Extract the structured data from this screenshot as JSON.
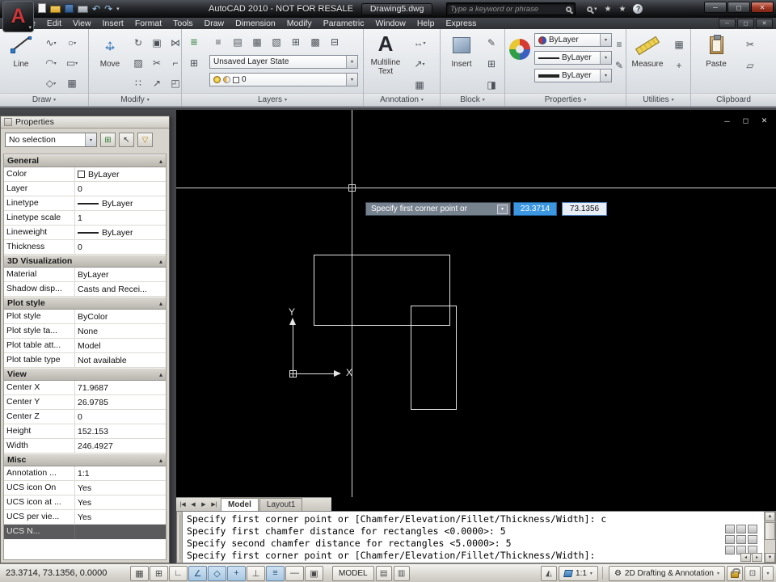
{
  "window": {
    "logo_letter": "A",
    "app_title": "AutoCAD 2010 - NOT FOR RESALE",
    "doc_title": "Drawing5.dwg"
  },
  "search": {
    "placeholder": "Type a keyword or phrase"
  },
  "menu": {
    "items": [
      "File",
      "Edit",
      "View",
      "Insert",
      "Format",
      "Tools",
      "Draw",
      "Dimension",
      "Modify",
      "Parametric",
      "Window",
      "Help",
      "Express"
    ]
  },
  "ribbon": {
    "draw": {
      "label": "Draw",
      "line": "Line",
      "icons": [
        "∿",
        "○",
        "◠",
        "▭",
        "◇",
        "▦"
      ]
    },
    "modify": {
      "label": "Modify",
      "move": "Move",
      "icons": [
        "↻",
        "▣",
        "⋈",
        "▨",
        "✂",
        "⌐",
        "∷",
        "↗",
        "◰"
      ]
    },
    "layers": {
      "label": "Layers",
      "state": "Unsaved Layer State",
      "current": "0",
      "icons": [
        "≡",
        "▤",
        "▦",
        "▧",
        "⊞",
        "▩",
        "⊟"
      ],
      "side_icons": [
        "≡",
        "⊞"
      ]
    },
    "annotation": {
      "label": "Annotation",
      "big_letter": "A",
      "multiline_text": "Multiline Text",
      "icons": [
        "↔",
        "↗",
        "▦"
      ]
    },
    "block": {
      "label": "Block",
      "insert": "Insert",
      "icons": [
        "✎",
        "⊞",
        "◨"
      ]
    },
    "properties": {
      "label": "Properties",
      "color": "ByLayer",
      "linetype": "ByLayer",
      "lineweight": "ByLayer",
      "side_icons": [
        "≡",
        "✎"
      ]
    },
    "utilities": {
      "label": "Utilities",
      "measure": "Measure",
      "icons": [
        "▦",
        "+"
      ]
    },
    "clipboard": {
      "label": "Clipboard",
      "paste": "Paste",
      "icons": [
        "✂",
        "▱"
      ]
    }
  },
  "palette": {
    "title": "Properties",
    "selection": "No selection",
    "sections": [
      {
        "name": "General",
        "rows": [
          {
            "label": "Color",
            "value": "ByLayer"
          },
          {
            "label": "Layer",
            "value": "0"
          },
          {
            "label": "Linetype",
            "value": "ByLayer"
          },
          {
            "label": "Linetype scale",
            "value": "1"
          },
          {
            "label": "Lineweight",
            "value": "ByLayer"
          },
          {
            "label": "Thickness",
            "value": "0"
          }
        ]
      },
      {
        "name": "3D Visualization",
        "rows": [
          {
            "label": "Material",
            "value": "ByLayer"
          },
          {
            "label": "Shadow disp...",
            "value": "Casts and Recei..."
          }
        ]
      },
      {
        "name": "Plot style",
        "rows": [
          {
            "label": "Plot style",
            "value": "ByColor"
          },
          {
            "label": "Plot style ta...",
            "value": "None"
          },
          {
            "label": "Plot table att...",
            "value": "Model"
          },
          {
            "label": "Plot table type",
            "value": "Not available"
          }
        ]
      },
      {
        "name": "View",
        "rows": [
          {
            "label": "Center X",
            "value": "71.9687"
          },
          {
            "label": "Center Y",
            "value": "26.9785"
          },
          {
            "label": "Center Z",
            "value": "0"
          },
          {
            "label": "Height",
            "value": "152.153"
          },
          {
            "label": "Width",
            "value": "246.4927"
          }
        ]
      },
      {
        "name": "Misc",
        "rows": [
          {
            "label": "Annotation ...",
            "value": "1:1"
          },
          {
            "label": "UCS icon On",
            "value": "Yes"
          },
          {
            "label": "UCS icon at ...",
            "value": "Yes"
          },
          {
            "label": "UCS per vie...",
            "value": "Yes"
          },
          {
            "label": "UCS N...",
            "value": ""
          }
        ]
      }
    ]
  },
  "drawing": {
    "dyn_prompt": "Specify first corner point or",
    "dyn_x": "23.3714",
    "dyn_y": "73.1356",
    "ucs_x": "X",
    "ucs_y": "Y"
  },
  "tabs": {
    "nav": [
      "|◀",
      "◀",
      "▶",
      "▶|"
    ],
    "model": "Model",
    "layout1": "Layout1"
  },
  "command": {
    "lines": [
      "Specify first corner point or [Chamfer/Elevation/Fillet/Thickness/Width]: c",
      "Specify first chamfer distance for rectangles <0.0000>: 5",
      "Specify second chamfer distance for rectangles <5.0000>: 5",
      "Specify first corner point or [Chamfer/Elevation/Fillet/Thickness/Width]:"
    ]
  },
  "status": {
    "coordinates": "23.3714, 73.1356, 0.0000",
    "toggle_glyphs": [
      "▦",
      "⊞",
      "∟",
      "∠",
      "◇",
      "+",
      "⊥",
      "≡",
      "―",
      "▣"
    ],
    "quickview_glyphs": [
      "▤",
      "▥"
    ],
    "model": "MODEL",
    "scale": "1:1",
    "workspace": "2D Drafting & Annotation"
  },
  "icons": {
    "caret": "▾",
    "collapse": "▴",
    "minimize": "─",
    "maximize": "◻",
    "close": "✕",
    "undo": "↶",
    "redo": "↷",
    "star": "★",
    "help": "?",
    "gear": "⚙",
    "clean_screen": "⊡",
    "annotation_vis": "◭",
    "scroll_up": "▲",
    "scroll_down": "▼",
    "scroll_left": "◂",
    "scroll_right": "▸"
  }
}
